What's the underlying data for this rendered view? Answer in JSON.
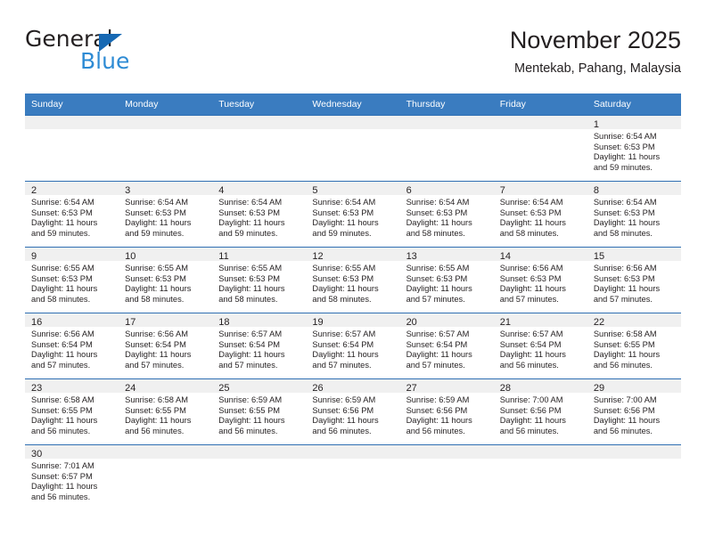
{
  "brand": {
    "name_top": "General",
    "name_bottom": "Blue",
    "triangle_color": "#1668b3",
    "blue_text_color": "#2e8bd4"
  },
  "header": {
    "title": "November 2025",
    "subtitle": "Mentekab, Pahang, Malaysia"
  },
  "theme": {
    "header_blue": "#3a7cc0",
    "row_border_blue": "#2f6fb3",
    "daynum_band": "#f0f0f0",
    "text": "#231f20"
  },
  "weekdays": [
    "Sunday",
    "Monday",
    "Tuesday",
    "Wednesday",
    "Thursday",
    "Friday",
    "Saturday"
  ],
  "weeks": [
    [
      {
        "day": "",
        "sunrise": "",
        "sunset": "",
        "daylight1": "",
        "daylight2": ""
      },
      {
        "day": "",
        "sunrise": "",
        "sunset": "",
        "daylight1": "",
        "daylight2": ""
      },
      {
        "day": "",
        "sunrise": "",
        "sunset": "",
        "daylight1": "",
        "daylight2": ""
      },
      {
        "day": "",
        "sunrise": "",
        "sunset": "",
        "daylight1": "",
        "daylight2": ""
      },
      {
        "day": "",
        "sunrise": "",
        "sunset": "",
        "daylight1": "",
        "daylight2": ""
      },
      {
        "day": "",
        "sunrise": "",
        "sunset": "",
        "daylight1": "",
        "daylight2": ""
      },
      {
        "day": "1",
        "sunrise": "Sunrise: 6:54 AM",
        "sunset": "Sunset: 6:53 PM",
        "daylight1": "Daylight: 11 hours",
        "daylight2": "and 59 minutes."
      }
    ],
    [
      {
        "day": "2",
        "sunrise": "Sunrise: 6:54 AM",
        "sunset": "Sunset: 6:53 PM",
        "daylight1": "Daylight: 11 hours",
        "daylight2": "and 59 minutes."
      },
      {
        "day": "3",
        "sunrise": "Sunrise: 6:54 AM",
        "sunset": "Sunset: 6:53 PM",
        "daylight1": "Daylight: 11 hours",
        "daylight2": "and 59 minutes."
      },
      {
        "day": "4",
        "sunrise": "Sunrise: 6:54 AM",
        "sunset": "Sunset: 6:53 PM",
        "daylight1": "Daylight: 11 hours",
        "daylight2": "and 59 minutes."
      },
      {
        "day": "5",
        "sunrise": "Sunrise: 6:54 AM",
        "sunset": "Sunset: 6:53 PM",
        "daylight1": "Daylight: 11 hours",
        "daylight2": "and 59 minutes."
      },
      {
        "day": "6",
        "sunrise": "Sunrise: 6:54 AM",
        "sunset": "Sunset: 6:53 PM",
        "daylight1": "Daylight: 11 hours",
        "daylight2": "and 58 minutes."
      },
      {
        "day": "7",
        "sunrise": "Sunrise: 6:54 AM",
        "sunset": "Sunset: 6:53 PM",
        "daylight1": "Daylight: 11 hours",
        "daylight2": "and 58 minutes."
      },
      {
        "day": "8",
        "sunrise": "Sunrise: 6:54 AM",
        "sunset": "Sunset: 6:53 PM",
        "daylight1": "Daylight: 11 hours",
        "daylight2": "and 58 minutes."
      }
    ],
    [
      {
        "day": "9",
        "sunrise": "Sunrise: 6:55 AM",
        "sunset": "Sunset: 6:53 PM",
        "daylight1": "Daylight: 11 hours",
        "daylight2": "and 58 minutes."
      },
      {
        "day": "10",
        "sunrise": "Sunrise: 6:55 AM",
        "sunset": "Sunset: 6:53 PM",
        "daylight1": "Daylight: 11 hours",
        "daylight2": "and 58 minutes."
      },
      {
        "day": "11",
        "sunrise": "Sunrise: 6:55 AM",
        "sunset": "Sunset: 6:53 PM",
        "daylight1": "Daylight: 11 hours",
        "daylight2": "and 58 minutes."
      },
      {
        "day": "12",
        "sunrise": "Sunrise: 6:55 AM",
        "sunset": "Sunset: 6:53 PM",
        "daylight1": "Daylight: 11 hours",
        "daylight2": "and 58 minutes."
      },
      {
        "day": "13",
        "sunrise": "Sunrise: 6:55 AM",
        "sunset": "Sunset: 6:53 PM",
        "daylight1": "Daylight: 11 hours",
        "daylight2": "and 57 minutes."
      },
      {
        "day": "14",
        "sunrise": "Sunrise: 6:56 AM",
        "sunset": "Sunset: 6:53 PM",
        "daylight1": "Daylight: 11 hours",
        "daylight2": "and 57 minutes."
      },
      {
        "day": "15",
        "sunrise": "Sunrise: 6:56 AM",
        "sunset": "Sunset: 6:53 PM",
        "daylight1": "Daylight: 11 hours",
        "daylight2": "and 57 minutes."
      }
    ],
    [
      {
        "day": "16",
        "sunrise": "Sunrise: 6:56 AM",
        "sunset": "Sunset: 6:54 PM",
        "daylight1": "Daylight: 11 hours",
        "daylight2": "and 57 minutes."
      },
      {
        "day": "17",
        "sunrise": "Sunrise: 6:56 AM",
        "sunset": "Sunset: 6:54 PM",
        "daylight1": "Daylight: 11 hours",
        "daylight2": "and 57 minutes."
      },
      {
        "day": "18",
        "sunrise": "Sunrise: 6:57 AM",
        "sunset": "Sunset: 6:54 PM",
        "daylight1": "Daylight: 11 hours",
        "daylight2": "and 57 minutes."
      },
      {
        "day": "19",
        "sunrise": "Sunrise: 6:57 AM",
        "sunset": "Sunset: 6:54 PM",
        "daylight1": "Daylight: 11 hours",
        "daylight2": "and 57 minutes."
      },
      {
        "day": "20",
        "sunrise": "Sunrise: 6:57 AM",
        "sunset": "Sunset: 6:54 PM",
        "daylight1": "Daylight: 11 hours",
        "daylight2": "and 57 minutes."
      },
      {
        "day": "21",
        "sunrise": "Sunrise: 6:57 AM",
        "sunset": "Sunset: 6:54 PM",
        "daylight1": "Daylight: 11 hours",
        "daylight2": "and 56 minutes."
      },
      {
        "day": "22",
        "sunrise": "Sunrise: 6:58 AM",
        "sunset": "Sunset: 6:55 PM",
        "daylight1": "Daylight: 11 hours",
        "daylight2": "and 56 minutes."
      }
    ],
    [
      {
        "day": "23",
        "sunrise": "Sunrise: 6:58 AM",
        "sunset": "Sunset: 6:55 PM",
        "daylight1": "Daylight: 11 hours",
        "daylight2": "and 56 minutes."
      },
      {
        "day": "24",
        "sunrise": "Sunrise: 6:58 AM",
        "sunset": "Sunset: 6:55 PM",
        "daylight1": "Daylight: 11 hours",
        "daylight2": "and 56 minutes."
      },
      {
        "day": "25",
        "sunrise": "Sunrise: 6:59 AM",
        "sunset": "Sunset: 6:55 PM",
        "daylight1": "Daylight: 11 hours",
        "daylight2": "and 56 minutes."
      },
      {
        "day": "26",
        "sunrise": "Sunrise: 6:59 AM",
        "sunset": "Sunset: 6:56 PM",
        "daylight1": "Daylight: 11 hours",
        "daylight2": "and 56 minutes."
      },
      {
        "day": "27",
        "sunrise": "Sunrise: 6:59 AM",
        "sunset": "Sunset: 6:56 PM",
        "daylight1": "Daylight: 11 hours",
        "daylight2": "and 56 minutes."
      },
      {
        "day": "28",
        "sunrise": "Sunrise: 7:00 AM",
        "sunset": "Sunset: 6:56 PM",
        "daylight1": "Daylight: 11 hours",
        "daylight2": "and 56 minutes."
      },
      {
        "day": "29",
        "sunrise": "Sunrise: 7:00 AM",
        "sunset": "Sunset: 6:56 PM",
        "daylight1": "Daylight: 11 hours",
        "daylight2": "and 56 minutes."
      }
    ],
    [
      {
        "day": "30",
        "sunrise": "Sunrise: 7:01 AM",
        "sunset": "Sunset: 6:57 PM",
        "daylight1": "Daylight: 11 hours",
        "daylight2": "and 56 minutes."
      },
      {
        "day": "",
        "sunrise": "",
        "sunset": "",
        "daylight1": "",
        "daylight2": ""
      },
      {
        "day": "",
        "sunrise": "",
        "sunset": "",
        "daylight1": "",
        "daylight2": ""
      },
      {
        "day": "",
        "sunrise": "",
        "sunset": "",
        "daylight1": "",
        "daylight2": ""
      },
      {
        "day": "",
        "sunrise": "",
        "sunset": "",
        "daylight1": "",
        "daylight2": ""
      },
      {
        "day": "",
        "sunrise": "",
        "sunset": "",
        "daylight1": "",
        "daylight2": ""
      },
      {
        "day": "",
        "sunrise": "",
        "sunset": "",
        "daylight1": "",
        "daylight2": ""
      }
    ]
  ]
}
